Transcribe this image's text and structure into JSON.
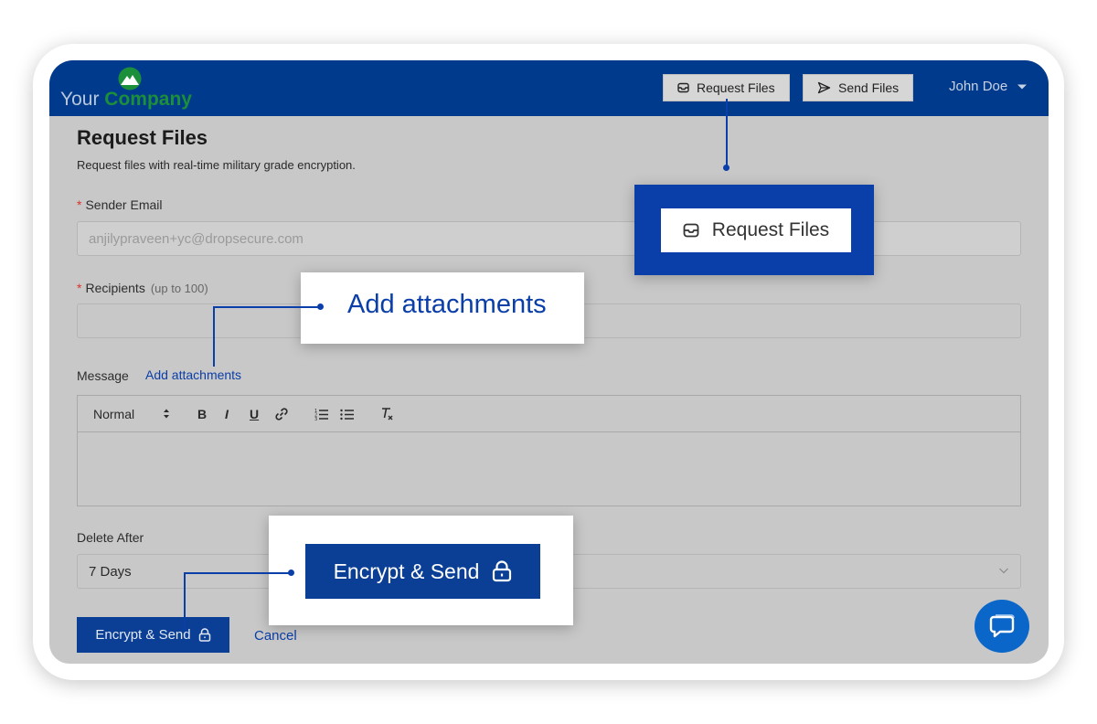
{
  "header": {
    "logo_your": "Your",
    "logo_company": "Company",
    "request_files_label": "Request Files",
    "send_files_label": "Send Files",
    "user_name": "John Doe"
  },
  "page": {
    "title": "Request Files",
    "subtitle": "Request files with real-time military grade encryption."
  },
  "form": {
    "sender_email_label": "Sender Email",
    "sender_email_value": "anjilypraveen+yc@dropsecure.com",
    "recipients_label": "Recipients",
    "recipients_hint": "(up to 100)",
    "recipients_value": "",
    "message_label": "Message",
    "add_attachments_link": "Add attachments",
    "editor_format": "Normal",
    "editor_tools": [
      "B",
      "I",
      "U",
      "link-icon",
      "ordered-list-icon",
      "bullet-list-icon",
      "clear-format-icon"
    ],
    "delete_after_label": "Delete After",
    "delete_after_value": "7 Days",
    "encrypt_send_label": "Encrypt & Send",
    "cancel_label": "Cancel"
  },
  "callouts": {
    "request_files": "Request Files",
    "add_attachments": "Add attachments",
    "encrypt_send": "Encrypt & Send"
  },
  "colors": {
    "header_bg": "#003a8c",
    "brand_green": "#1c8f3a",
    "primary_button": "#0a3f95",
    "link": "#0a3ea8",
    "chat": "#0a67c9"
  }
}
